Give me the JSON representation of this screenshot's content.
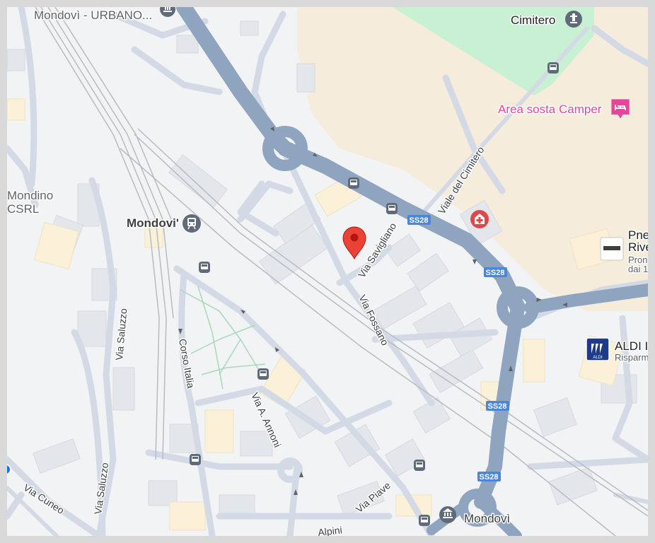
{
  "map": {
    "colors": {
      "background": "#f1f3f4",
      "major_road": "#8fa4bf",
      "minor_road": "#d3dae5",
      "building": "#e3e6ea",
      "building_warm": "#fbf0d8",
      "park": "#c8f0d2",
      "land_tan": "#f5ecdc",
      "rail": "#b7bcc4",
      "pin": "#ea4335",
      "transit_blue": "#1a73e8",
      "hospital_red": "#e04848",
      "pink_poi": "#e8449b"
    },
    "place_labels": {
      "mondovi_urbano": "Mondovì - URBANO...",
      "mondino_line1": "Mondino",
      "mondino_line2": "CSRL",
      "mondovi_station": "Mondovi'",
      "mondovi_bottom": "Mondovì"
    },
    "street_labels": {
      "via_savigliano": "Via Savigliano",
      "viale_del_cimitero": "Viale del Cimitero",
      "via_fossano": "Via Fossano",
      "corso_italia": "Corso Italia",
      "via_a_annoni": "Via A. Annoni",
      "via_saluzzo_top": "Via Saluzzo",
      "via_saluzzo_bottom": "Via Saluzzo",
      "via_cuneo": "Via Cuneo",
      "via_piave": "Via Piave",
      "alpini": "Alpini"
    },
    "route_shields": [
      "SS28",
      "SS28",
      "SS28",
      "SS28"
    ],
    "poi": {
      "cimitero": "Cimitero",
      "area_sosta_camper": "Area sosta Camper",
      "pneus_line1": "Pne",
      "pneus_line2": "Rive",
      "pneus_line3": "Pron",
      "pneus_line4": "dai 1",
      "aldi": "ALDI I",
      "aldi_sub": "Risparm",
      "aldi_logo_text": "ALDI"
    },
    "icons": {
      "pin": "map-pin-icon",
      "bus": "bus-stop-icon",
      "train": "train-station-icon",
      "hospital": "hospital-icon",
      "camper": "hotel-bed-icon",
      "monument": "monument-icon",
      "pneus_logo": "store-logo-icon",
      "aldi_logo": "aldi-logo-icon"
    }
  }
}
